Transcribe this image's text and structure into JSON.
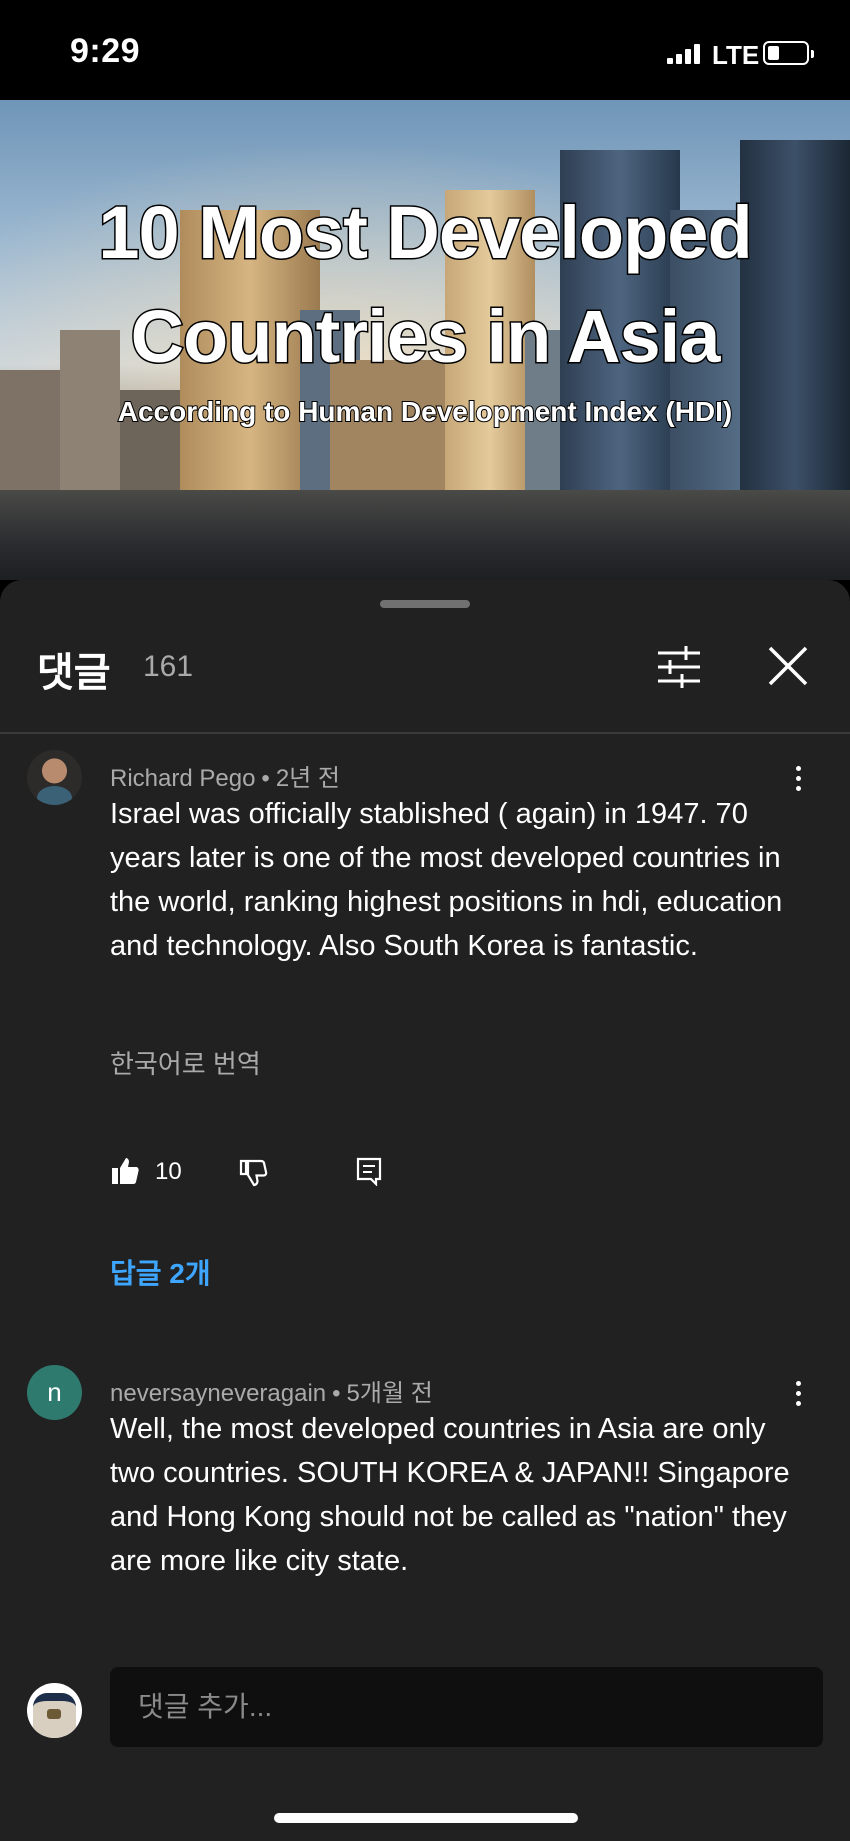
{
  "status_bar": {
    "time": "9:29",
    "network": "LTE"
  },
  "video": {
    "title_line1": "10 Most Developed",
    "title_line2": "Countries in Asia",
    "subtitle": "According to Human Development Index (HDI)",
    "progress": 0.04
  },
  "comments_panel": {
    "title": "댓글",
    "count": "161",
    "filter_icon": "sliders-icon",
    "close_icon": "close-icon",
    "comments": [
      {
        "author": "Richard Pego",
        "time": "2년 전",
        "text": "Israel was officially stablished ( again) in 1947. 70 years later is one of the most developed countries in the world, ranking highest positions in hdi, education and technology. Also South Korea is fantastic.",
        "translate_label": "한국어로 번역",
        "likes": "10",
        "replies_label": "답글 2개"
      },
      {
        "author": "neversayneveragain",
        "avatar_letter": "n",
        "time": "5개월 전",
        "text": "Well, the most developed countries in Asia are only two countries. SOUTH KOREA & JAPAN!! Singapore and Hong Kong should not be called as \"nation\" they are more like city state."
      }
    ],
    "add_comment_placeholder": "댓글 추가..."
  }
}
